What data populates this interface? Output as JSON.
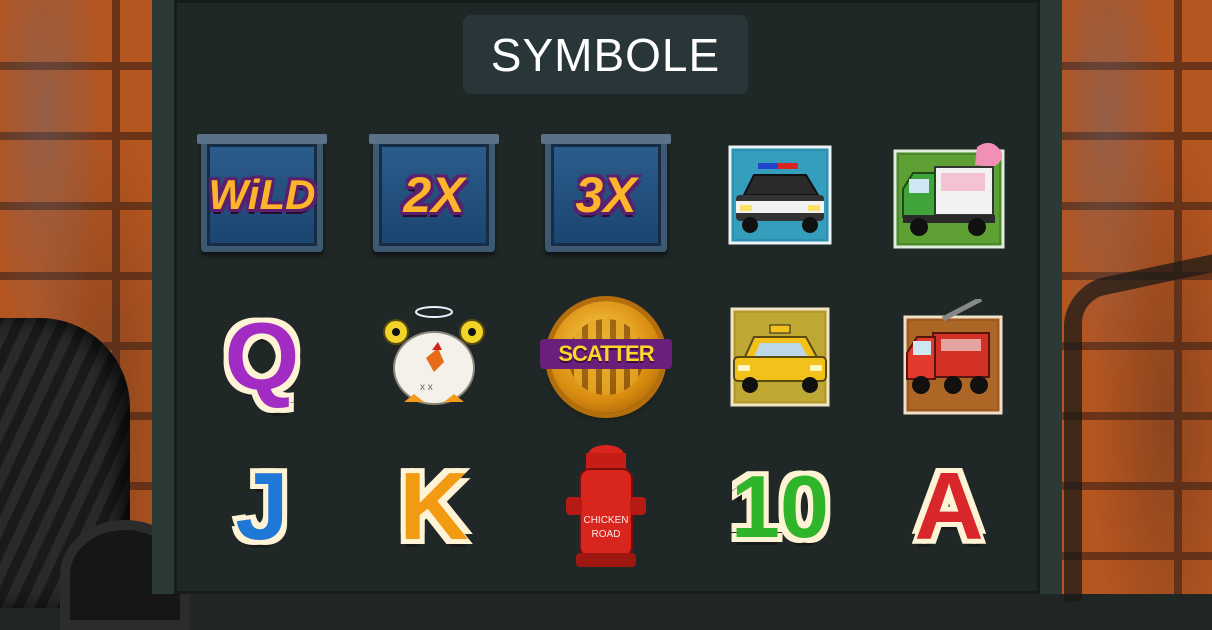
{
  "header": {
    "title": "SYMBOLE"
  },
  "symbols": {
    "wild": {
      "label": "WiLD",
      "name": "wild-symbol"
    },
    "x2": {
      "label": "2X",
      "name": "multiplier-2x"
    },
    "x3": {
      "label": "3X",
      "name": "multiplier-3x"
    },
    "police_car": {
      "name": "police-car"
    },
    "ice_cream_truck": {
      "name": "ice-cream-truck"
    },
    "q": {
      "label": "Q"
    },
    "chicken": {
      "name": "chicken"
    },
    "scatter": {
      "label": "SCATTER"
    },
    "taxi": {
      "name": "taxi"
    },
    "fire_truck": {
      "name": "fire-truck"
    },
    "j": {
      "label": "J"
    },
    "k": {
      "label": "K"
    },
    "hydrant": {
      "label_line1": "CHICKEN",
      "label_line2": "ROAD"
    },
    "ten": {
      "label": "10"
    },
    "a": {
      "label": "A"
    }
  },
  "colors": {
    "panel": "#1f2826",
    "title_bg": "#28363a",
    "q": "#a22bc4",
    "j": "#1f77d6",
    "k": "#f29a12",
    "ten": "#2fb52a",
    "a": "#d9262b"
  }
}
